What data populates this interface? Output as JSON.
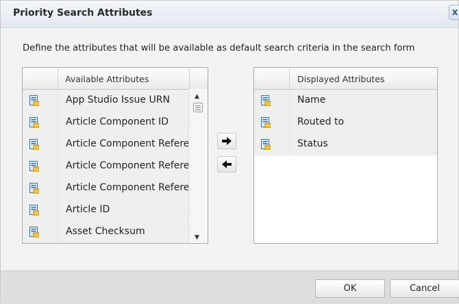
{
  "dialog": {
    "title": "Priority Search Attributes",
    "close_label": "x",
    "description": "Define the attributes that will be available as default search criteria in the search form"
  },
  "available": {
    "header": "Available Attributes",
    "items": [
      "App Studio Issue URN",
      "Article Component ID",
      "Article Component Reference",
      "Article Component Reference",
      "Article Component Reference",
      "Article ID",
      "Asset Checksum"
    ]
  },
  "displayed": {
    "header": "Displayed Attributes",
    "items": [
      "Name",
      "Routed to",
      "Status"
    ]
  },
  "movers": {
    "add_icon": "arrow-right-icon",
    "remove_icon": "arrow-left-icon"
  },
  "footer": {
    "ok_label": "OK",
    "cancel_label": "Cancel"
  }
}
